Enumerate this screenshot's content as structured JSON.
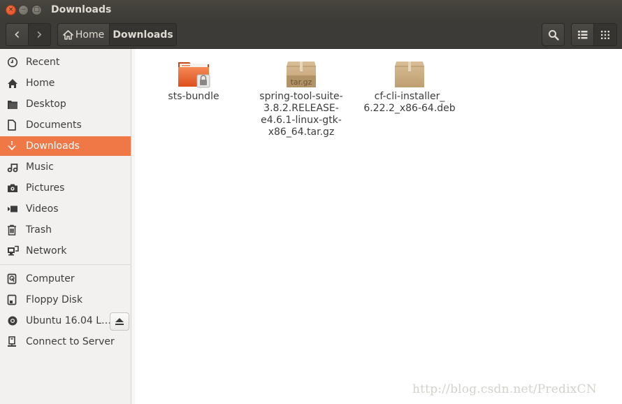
{
  "window": {
    "title": "Downloads",
    "controls": {
      "close": "×",
      "minimize": "−",
      "maximize": "□"
    }
  },
  "toolbar": {
    "back_icon": "‹",
    "forward_icon": "›",
    "breadcrumbs": [
      {
        "label": "Home",
        "icon": "home-icon"
      },
      {
        "label": "Downloads"
      }
    ]
  },
  "sidebar": {
    "places": [
      {
        "label": "Recent",
        "icon": "clock-icon"
      },
      {
        "label": "Home",
        "icon": "home-icon"
      },
      {
        "label": "Desktop",
        "icon": "folder-icon"
      },
      {
        "label": "Documents",
        "icon": "document-icon"
      },
      {
        "label": "Downloads",
        "icon": "download-icon",
        "selected": true
      },
      {
        "label": "Music",
        "icon": "music-icon"
      },
      {
        "label": "Pictures",
        "icon": "camera-icon"
      },
      {
        "label": "Videos",
        "icon": "video-icon"
      },
      {
        "label": "Trash",
        "icon": "trash-icon"
      },
      {
        "label": "Network",
        "icon": "network-icon"
      }
    ],
    "devices": [
      {
        "label": "Computer",
        "icon": "harddisk-icon"
      },
      {
        "label": "Floppy Disk",
        "icon": "floppy-icon"
      },
      {
        "label": "Ubuntu 16.04 L…",
        "icon": "disc-icon",
        "ejectable": true
      },
      {
        "label": "Connect to Server",
        "icon": "server-icon"
      }
    ]
  },
  "files": [
    {
      "name": "sts-bundle",
      "type": "folder-locked"
    },
    {
      "name": "spring-tool-suite-3.8.2.RELEASE-e4.6.1-linux-gtk-x86_64.tar.gz",
      "lines": [
        "spring-tool-suite-",
        "3.8.2.RELEASE-",
        "e4.6.1-linux-gtk-",
        "x86_64.tar.gz"
      ],
      "type": "archive",
      "badge": "tar.gz"
    },
    {
      "name": "cf-cli-installer_6.22.2_x86-64.deb",
      "lines": [
        "cf-cli-installer_",
        "6.22.2_x86-64.deb"
      ],
      "type": "package"
    }
  ],
  "watermark": "http://blog.csdn.net/PredixCN",
  "colors": {
    "accent": "#f07746",
    "titlebar": "#3d3b36",
    "sidebar": "#f2f1f0"
  }
}
